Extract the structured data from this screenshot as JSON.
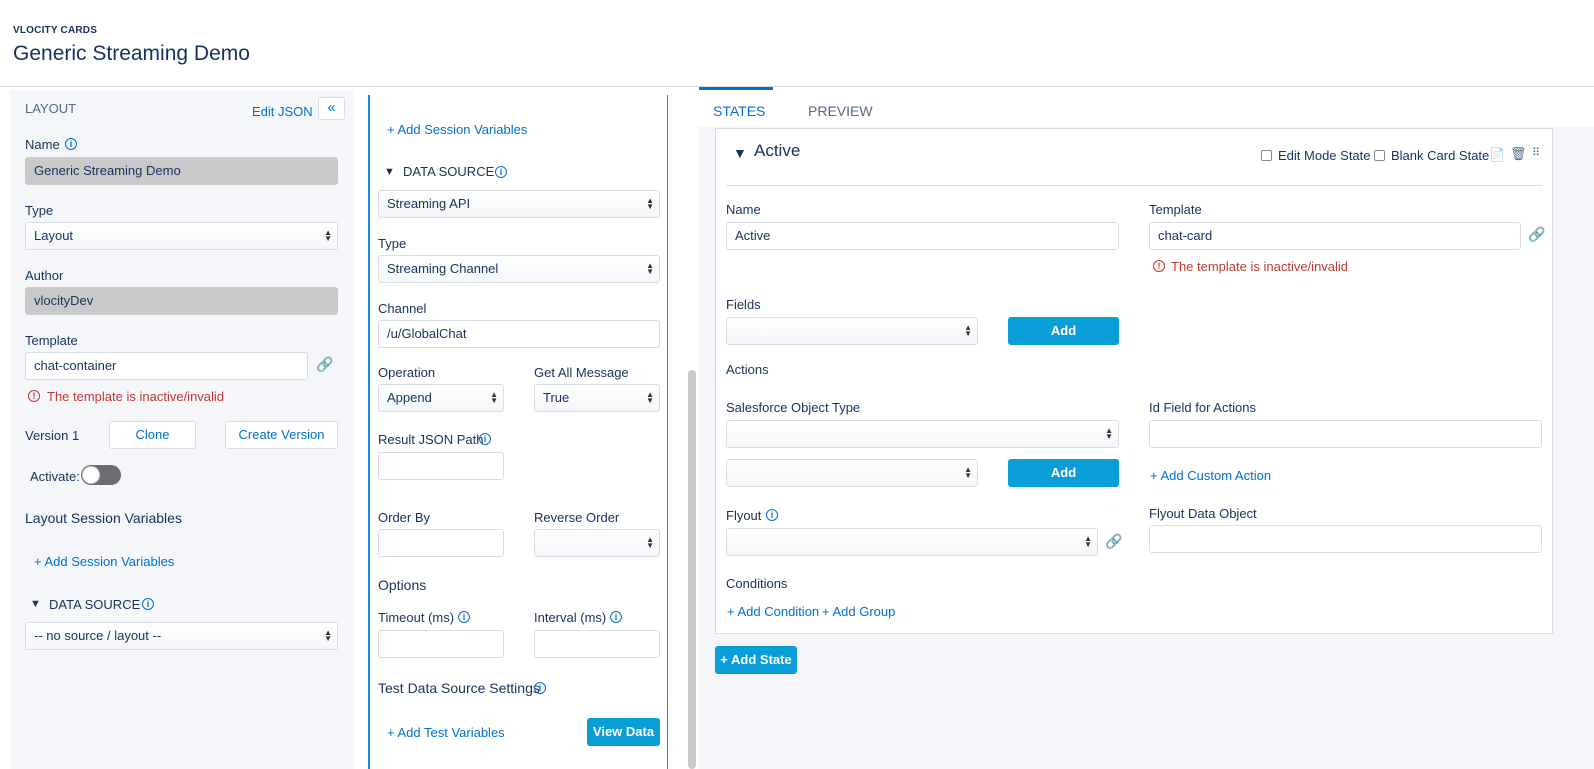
{
  "header": {
    "eyebrow": "VLOCITY CARDS",
    "title": "Generic Streaming Demo"
  },
  "left": {
    "section_title": "LAYOUT",
    "edit_json": "Edit JSON",
    "name_label": "Name",
    "name_value": "Generic Streaming Demo",
    "type_label": "Type",
    "type_value": "Layout",
    "author_label": "Author",
    "author_value": "vlocityDev",
    "template_label": "Template",
    "template_value": "chat-container",
    "template_error": "The template is inactive/invalid",
    "version": "Version 1",
    "clone": "Clone",
    "create_version": "Create Version",
    "activate": "Activate:",
    "session_vars": "Layout Session Variables",
    "add_session_vars": "+ Add Session Variables",
    "data_source": "DATA SOURCE",
    "data_source_value": "-- no source / layout --"
  },
  "mid": {
    "add_session_vars": "+ Add Session Variables",
    "data_source": "DATA SOURCE",
    "data_source_value": "Streaming API",
    "type_label": "Type",
    "type_value": "Streaming Channel",
    "channel_label": "Channel",
    "channel_value": "/u/GlobalChat",
    "operation_label": "Operation",
    "operation_value": "Append",
    "get_all_label": "Get All Message",
    "get_all_value": "True",
    "result_json_label": "Result JSON Path",
    "order_by_label": "Order By",
    "reverse_order_label": "Reverse Order",
    "options_label": "Options",
    "timeout_label": "Timeout (ms)",
    "interval_label": "Interval (ms)",
    "test_settings_label": "Test Data Source Settings",
    "add_test_vars": "+ Add Test Variables",
    "view_data": "View Data"
  },
  "right": {
    "tabs": [
      "STATES",
      "PREVIEW"
    ],
    "state_name": "Active",
    "edit_mode_state": "Edit Mode State",
    "blank_card_state": "Blank Card State",
    "name_label": "Name",
    "name_value": "Active",
    "template_label": "Template",
    "template_value": "chat-card",
    "template_error": "The template is inactive/invalid",
    "fields_label": "Fields",
    "add": "Add",
    "actions_label": "Actions",
    "sf_object_label": "Salesforce Object Type",
    "id_field_label": "Id Field for Actions",
    "add_custom_action": "+ Add Custom Action",
    "flyout_label": "Flyout",
    "flyout_data_label": "Flyout Data Object",
    "conditions_label": "Conditions",
    "add_condition": "+ Add Condition",
    "add_group": "+ Add Group",
    "add_state": "+ Add State"
  },
  "colors": {
    "brand": "#0a9ed9",
    "link": "#0070d2",
    "error": "#c23934",
    "text": "#16325c"
  }
}
